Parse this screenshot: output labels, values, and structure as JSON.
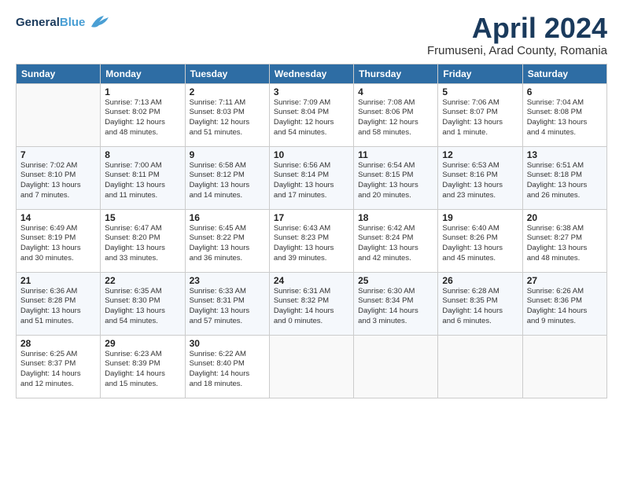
{
  "header": {
    "logo_general": "General",
    "logo_blue": "Blue",
    "month": "April 2024",
    "location": "Frumuseni, Arad County, Romania"
  },
  "weekdays": [
    "Sunday",
    "Monday",
    "Tuesday",
    "Wednesday",
    "Thursday",
    "Friday",
    "Saturday"
  ],
  "weeks": [
    [
      {
        "day": "",
        "info": ""
      },
      {
        "day": "1",
        "info": "Sunrise: 7:13 AM\nSunset: 8:02 PM\nDaylight: 12 hours\nand 48 minutes."
      },
      {
        "day": "2",
        "info": "Sunrise: 7:11 AM\nSunset: 8:03 PM\nDaylight: 12 hours\nand 51 minutes."
      },
      {
        "day": "3",
        "info": "Sunrise: 7:09 AM\nSunset: 8:04 PM\nDaylight: 12 hours\nand 54 minutes."
      },
      {
        "day": "4",
        "info": "Sunrise: 7:08 AM\nSunset: 8:06 PM\nDaylight: 12 hours\nand 58 minutes."
      },
      {
        "day": "5",
        "info": "Sunrise: 7:06 AM\nSunset: 8:07 PM\nDaylight: 13 hours\nand 1 minute."
      },
      {
        "day": "6",
        "info": "Sunrise: 7:04 AM\nSunset: 8:08 PM\nDaylight: 13 hours\nand 4 minutes."
      }
    ],
    [
      {
        "day": "7",
        "info": "Sunrise: 7:02 AM\nSunset: 8:10 PM\nDaylight: 13 hours\nand 7 minutes."
      },
      {
        "day": "8",
        "info": "Sunrise: 7:00 AM\nSunset: 8:11 PM\nDaylight: 13 hours\nand 11 minutes."
      },
      {
        "day": "9",
        "info": "Sunrise: 6:58 AM\nSunset: 8:12 PM\nDaylight: 13 hours\nand 14 minutes."
      },
      {
        "day": "10",
        "info": "Sunrise: 6:56 AM\nSunset: 8:14 PM\nDaylight: 13 hours\nand 17 minutes."
      },
      {
        "day": "11",
        "info": "Sunrise: 6:54 AM\nSunset: 8:15 PM\nDaylight: 13 hours\nand 20 minutes."
      },
      {
        "day": "12",
        "info": "Sunrise: 6:53 AM\nSunset: 8:16 PM\nDaylight: 13 hours\nand 23 minutes."
      },
      {
        "day": "13",
        "info": "Sunrise: 6:51 AM\nSunset: 8:18 PM\nDaylight: 13 hours\nand 26 minutes."
      }
    ],
    [
      {
        "day": "14",
        "info": "Sunrise: 6:49 AM\nSunset: 8:19 PM\nDaylight: 13 hours\nand 30 minutes."
      },
      {
        "day": "15",
        "info": "Sunrise: 6:47 AM\nSunset: 8:20 PM\nDaylight: 13 hours\nand 33 minutes."
      },
      {
        "day": "16",
        "info": "Sunrise: 6:45 AM\nSunset: 8:22 PM\nDaylight: 13 hours\nand 36 minutes."
      },
      {
        "day": "17",
        "info": "Sunrise: 6:43 AM\nSunset: 8:23 PM\nDaylight: 13 hours\nand 39 minutes."
      },
      {
        "day": "18",
        "info": "Sunrise: 6:42 AM\nSunset: 8:24 PM\nDaylight: 13 hours\nand 42 minutes."
      },
      {
        "day": "19",
        "info": "Sunrise: 6:40 AM\nSunset: 8:26 PM\nDaylight: 13 hours\nand 45 minutes."
      },
      {
        "day": "20",
        "info": "Sunrise: 6:38 AM\nSunset: 8:27 PM\nDaylight: 13 hours\nand 48 minutes."
      }
    ],
    [
      {
        "day": "21",
        "info": "Sunrise: 6:36 AM\nSunset: 8:28 PM\nDaylight: 13 hours\nand 51 minutes."
      },
      {
        "day": "22",
        "info": "Sunrise: 6:35 AM\nSunset: 8:30 PM\nDaylight: 13 hours\nand 54 minutes."
      },
      {
        "day": "23",
        "info": "Sunrise: 6:33 AM\nSunset: 8:31 PM\nDaylight: 13 hours\nand 57 minutes."
      },
      {
        "day": "24",
        "info": "Sunrise: 6:31 AM\nSunset: 8:32 PM\nDaylight: 14 hours\nand 0 minutes."
      },
      {
        "day": "25",
        "info": "Sunrise: 6:30 AM\nSunset: 8:34 PM\nDaylight: 14 hours\nand 3 minutes."
      },
      {
        "day": "26",
        "info": "Sunrise: 6:28 AM\nSunset: 8:35 PM\nDaylight: 14 hours\nand 6 minutes."
      },
      {
        "day": "27",
        "info": "Sunrise: 6:26 AM\nSunset: 8:36 PM\nDaylight: 14 hours\nand 9 minutes."
      }
    ],
    [
      {
        "day": "28",
        "info": "Sunrise: 6:25 AM\nSunset: 8:37 PM\nDaylight: 14 hours\nand 12 minutes."
      },
      {
        "day": "29",
        "info": "Sunrise: 6:23 AM\nSunset: 8:39 PM\nDaylight: 14 hours\nand 15 minutes."
      },
      {
        "day": "30",
        "info": "Sunrise: 6:22 AM\nSunset: 8:40 PM\nDaylight: 14 hours\nand 18 minutes."
      },
      {
        "day": "",
        "info": ""
      },
      {
        "day": "",
        "info": ""
      },
      {
        "day": "",
        "info": ""
      },
      {
        "day": "",
        "info": ""
      }
    ]
  ]
}
